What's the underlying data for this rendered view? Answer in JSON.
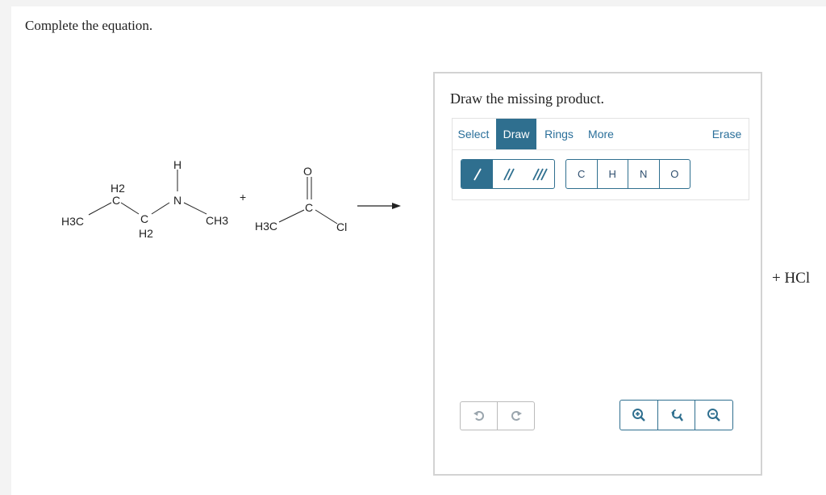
{
  "question": {
    "text": "Complete the equation."
  },
  "reaction": {
    "reactant1": {
      "h3c": "H3C",
      "ch2_top": "H2",
      "ch2_top_c": "C",
      "ch2_bottom_c": "C",
      "ch2_bottom": "H2",
      "n": "N",
      "h": "H",
      "ch3": "CH3"
    },
    "plus": "+",
    "reactant2": {
      "h3c": "H3C",
      "c": "C",
      "o": "O",
      "cl": "Cl"
    }
  },
  "sketcher": {
    "prompt": "Draw the missing product.",
    "tabs": [
      {
        "label": "Select",
        "active": false
      },
      {
        "label": "Draw",
        "active": true
      },
      {
        "label": "Rings",
        "active": false
      },
      {
        "label": "More",
        "active": false
      }
    ],
    "erase_label": "Erase",
    "bond_tools": [
      "single-bond",
      "double-bond",
      "triple-bond"
    ],
    "atoms": [
      "C",
      "H",
      "N",
      "O"
    ],
    "accent_color": "#2f6f8f"
  },
  "byproduct": {
    "text": "+ HCl"
  }
}
